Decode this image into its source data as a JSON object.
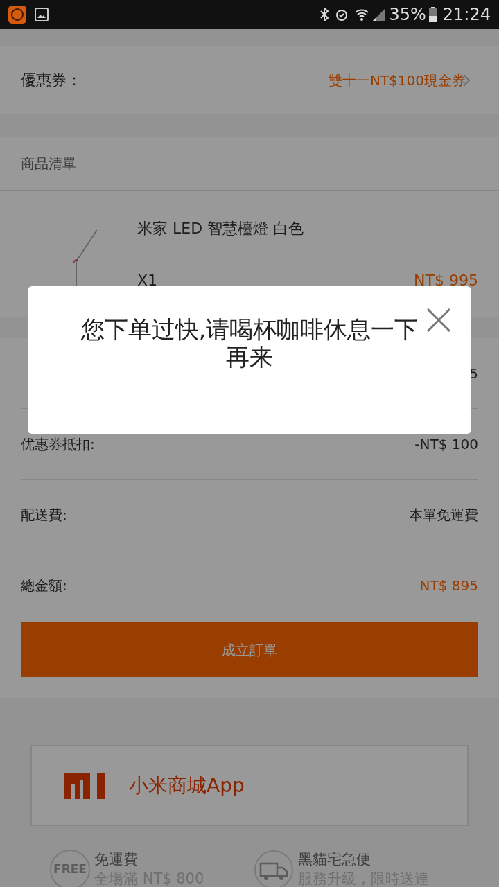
{
  "status_bar": {
    "battery": "35%",
    "time": "21:24"
  },
  "coupon": {
    "label": "優惠券：",
    "value": "雙十一NT$100現金券"
  },
  "items_section": {
    "title": "商品清單",
    "items": [
      {
        "name": "米家 LED 智慧檯燈 白色",
        "quantity": "X1",
        "price": "NT$ 995"
      }
    ]
  },
  "summary": [
    {
      "value": "5",
      "highlight": false
    },
    {
      "label": "优惠券抵扣:",
      "value": "-NT$ 100",
      "highlight": false
    },
    {
      "label": "配送費:",
      "value": "本單免運費",
      "highlight": false
    },
    {
      "label": "總金額:",
      "value": "NT$ 895",
      "highlight": true
    }
  ],
  "submit_button": "成立訂單",
  "app_banner": {
    "title": "小米商城App"
  },
  "features": [
    {
      "kind": "free",
      "badge": "FREE",
      "title": "免運費",
      "subtitle": "全場滿 NT$ 800"
    },
    {
      "kind": "truck",
      "title": "黑貓宅急便",
      "subtitle": "服務升級，限時送達"
    }
  ],
  "dialog": {
    "message": "您下单过快,请喝杯咖啡休息一下再来"
  }
}
